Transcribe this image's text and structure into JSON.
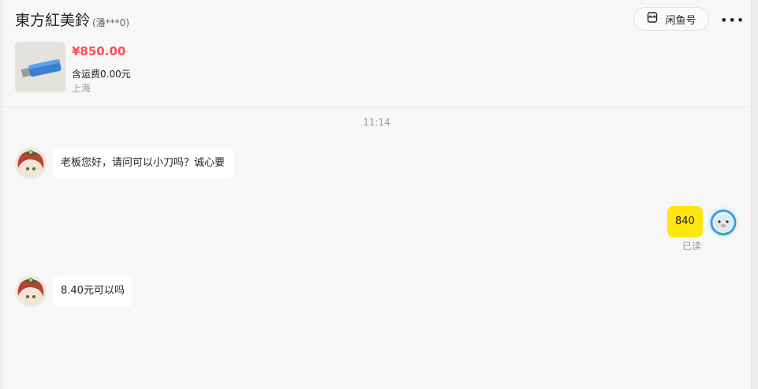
{
  "header": {
    "title": "東方紅美鈴",
    "subtitle": "(潘***0)",
    "id_button_label": "闲鱼号",
    "more_label": "•••"
  },
  "item": {
    "price": "¥850.00",
    "shipping": "含运费0.00元",
    "location": "上海"
  },
  "chat": {
    "timestamp": "11:14",
    "messages": [
      {
        "from": "other",
        "text": "老板您好，请问可以小刀吗？诚心要"
      },
      {
        "from": "me",
        "text": "840",
        "status": "已读"
      },
      {
        "from": "other",
        "text": "8.40元可以吗"
      }
    ]
  },
  "colors": {
    "accent_price": "#ff4d4f",
    "my_bubble": "#ffe60f",
    "their_bubble": "#ffffff"
  }
}
